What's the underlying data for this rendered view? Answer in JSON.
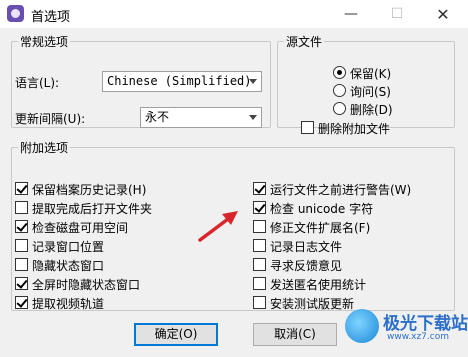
{
  "window": {
    "title": "首选项",
    "minimize": "—",
    "maximize": "☐",
    "close": "✕"
  },
  "general": {
    "legend": "常规选项",
    "language_label": "语言(L):",
    "language_value": "Chinese (Simplified)",
    "update_label": "更新间隔(U):",
    "update_value": "永不"
  },
  "source_files": {
    "legend": "源文件",
    "options": [
      {
        "label": "保留(K)",
        "selected": true
      },
      {
        "label": "询问(S)",
        "selected": false
      },
      {
        "label": "删除(D)",
        "selected": false
      }
    ],
    "delete_extra_label": "删除附加文件",
    "delete_extra_checked": false
  },
  "additional": {
    "legend": "附加选项",
    "left": [
      {
        "label": "保留档案历史记录(H)",
        "checked": true
      },
      {
        "label": "提取完成后打开文件夹",
        "checked": false
      },
      {
        "label": "检查磁盘可用空间",
        "checked": true
      },
      {
        "label": "记录窗口位置",
        "checked": false
      },
      {
        "label": "隐藏状态窗口",
        "checked": false
      },
      {
        "label": "全屏时隐藏状态窗口",
        "checked": true
      },
      {
        "label": "提取视频轨道",
        "checked": true
      }
    ],
    "right": [
      {
        "label": "运行文件之前进行警告(W)",
        "checked": true
      },
      {
        "label": "检查 unicode 字符",
        "checked": true
      },
      {
        "label": "修正文件扩展名(F)",
        "checked": false
      },
      {
        "label": "记录日志文件",
        "checked": false
      },
      {
        "label": "寻求反馈意见",
        "checked": false
      },
      {
        "label": "发送匿名使用统计",
        "checked": false
      },
      {
        "label": "安装测试版更新",
        "checked": false
      }
    ]
  },
  "buttons": {
    "ok": "确定(O)",
    "cancel": "取消(C)"
  },
  "watermark": {
    "name": "极光下载站",
    "url": "www.xz7.com"
  },
  "colors": {
    "accent": "#0078d7",
    "annotation_arrow": "#d9262c"
  }
}
